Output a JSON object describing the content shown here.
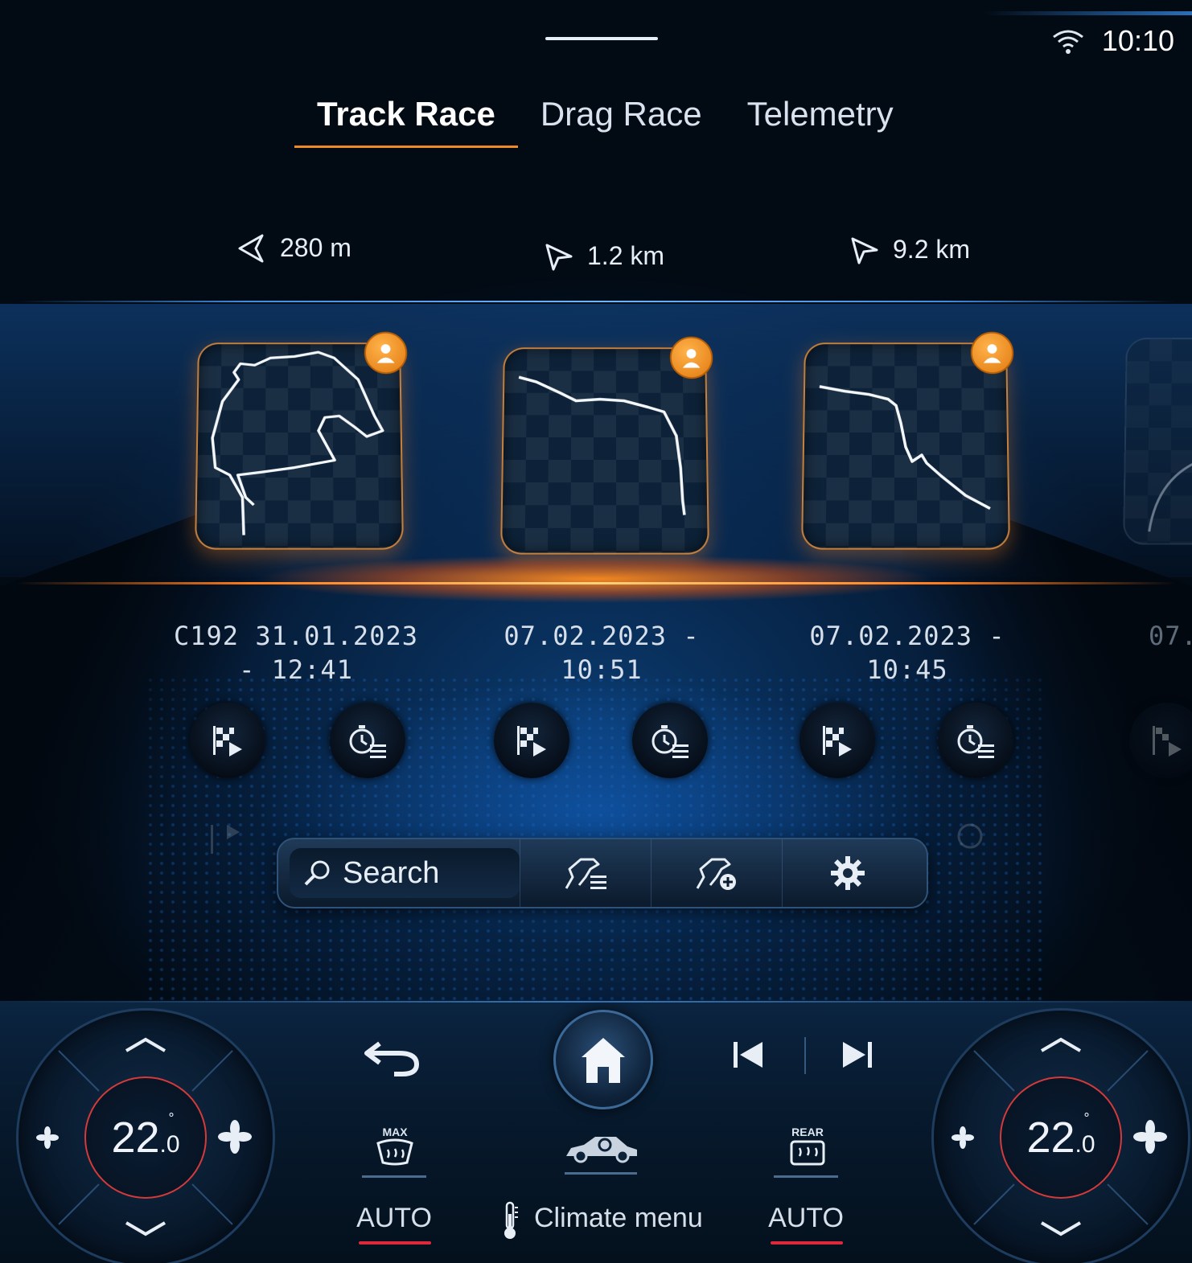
{
  "status": {
    "time": "10:10",
    "wifi_icon": "wifi-icon"
  },
  "tabs": [
    {
      "label": "Track Race",
      "active": true
    },
    {
      "label": "Drag Race",
      "active": false
    },
    {
      "label": "Telemetry",
      "active": false
    }
  ],
  "tracks": [
    {
      "distance": "280 m",
      "date_line1": "C192 31.01.2023",
      "date_line2": "- 12:41"
    },
    {
      "distance": "1.2 km",
      "date_line1": "07.02.2023 -",
      "date_line2": "10:51"
    },
    {
      "distance": "9.2 km",
      "date_line1": "07.02.2023 -",
      "date_line2": "10:45"
    },
    {
      "date_line1": "07."
    }
  ],
  "toolbar": {
    "search_label": "Search"
  },
  "climate": {
    "left_temp": "22",
    "left_temp_decimal": ".0",
    "right_temp": "22",
    "right_temp_decimal": ".0",
    "degree": "°",
    "max_label": "MAX",
    "rear_label": "REAR",
    "left_auto": "AUTO",
    "right_auto": "AUTO",
    "menu_label": "Climate menu"
  },
  "colors": {
    "accent": "#f08a24",
    "alert": "#e0283c",
    "glow": "#3b8ee8"
  }
}
